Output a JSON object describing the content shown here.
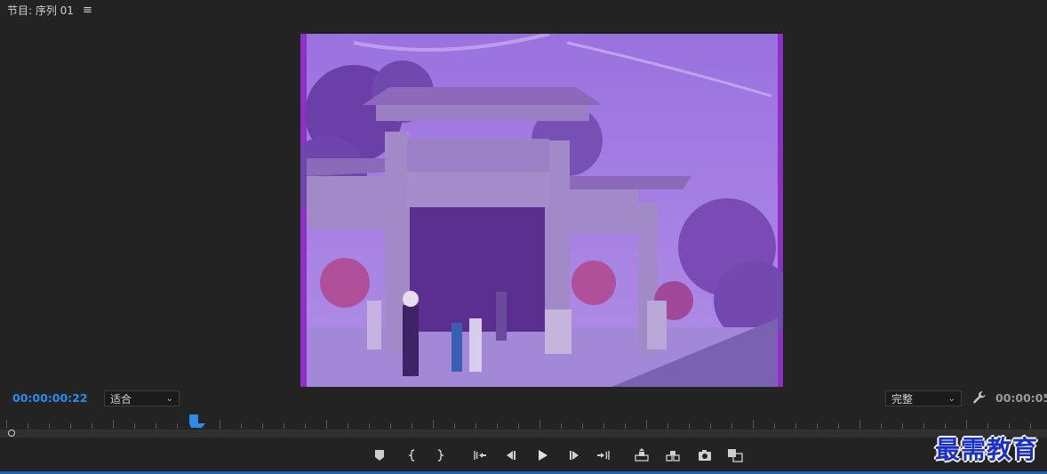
{
  "panel": {
    "title": "节目: 序列 01",
    "menu_icon": "≡"
  },
  "timecode": {
    "current": "00:00:00:22",
    "duration": "00:00:05:"
  },
  "zoom": {
    "selected": "适合"
  },
  "quality": {
    "selected": "完整"
  },
  "watermark": "最需教育",
  "colors": {
    "timecode_accent": "#2d8ceb",
    "frame_tint": "#8f2fc8",
    "background": "#232323",
    "bottom_bar": "#1f63b3"
  },
  "controls": [
    {
      "name": "add-marker-icon"
    },
    {
      "name": "mark-in-icon"
    },
    {
      "name": "mark-out-icon"
    },
    {
      "name": "go-to-in-icon"
    },
    {
      "name": "step-back-icon"
    },
    {
      "name": "play-icon"
    },
    {
      "name": "step-forward-icon"
    },
    {
      "name": "go-to-out-icon"
    },
    {
      "name": "lift-icon"
    },
    {
      "name": "extract-icon"
    },
    {
      "name": "export-frame-icon"
    },
    {
      "name": "comparison-view-icon"
    }
  ]
}
